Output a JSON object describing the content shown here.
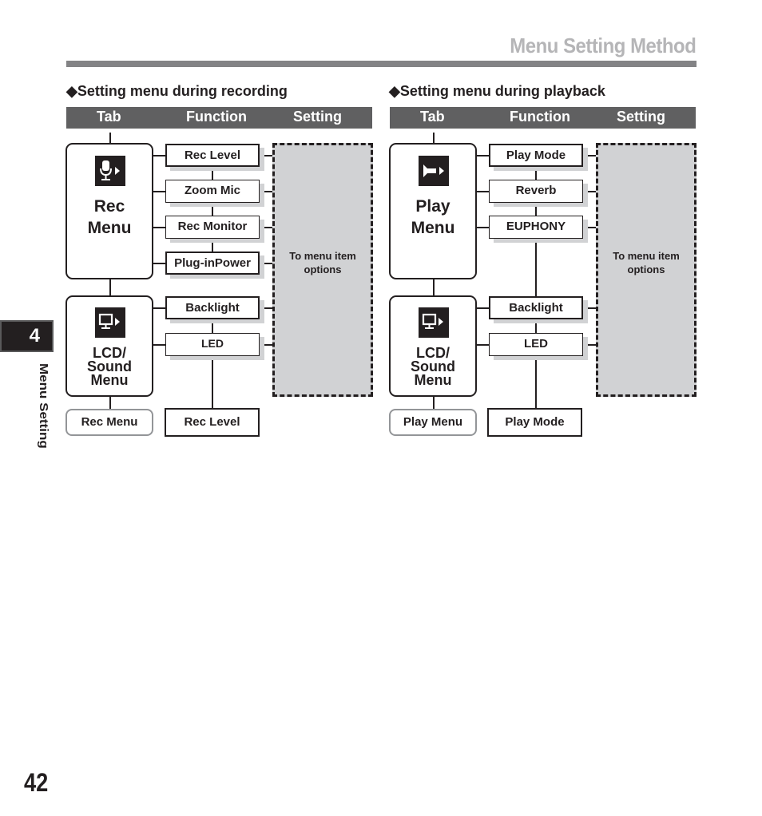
{
  "header": {
    "title": "Menu Setting Method"
  },
  "chapter": {
    "number": "4",
    "label": "Menu Setting"
  },
  "page_number": "42",
  "column_headers": {
    "tab": "Tab",
    "function": "Function",
    "setting": "Setting"
  },
  "recording": {
    "heading": "◆Setting menu during recording",
    "tabs": [
      {
        "label_lines": [
          "Rec",
          "Menu"
        ],
        "icon": "microphone-icon"
      },
      {
        "label_lines": [
          "LCD/",
          "Sound",
          "Menu"
        ],
        "icon": "monitor-icon"
      }
    ],
    "rec_menu_functions": [
      "Rec Level",
      "Zoom Mic",
      "Rec Monitor",
      "Plug-inPower"
    ],
    "lcd_menu_functions": [
      "Backlight",
      "LED"
    ],
    "return_tab": "Rec Menu",
    "return_function": "Rec Level",
    "setting_text_lines": [
      "To menu item",
      "options"
    ]
  },
  "playback": {
    "heading": "◆Setting menu during playback",
    "tabs": [
      {
        "label_lines": [
          "Play",
          "Menu"
        ],
        "icon": "play-icon"
      },
      {
        "label_lines": [
          "LCD/",
          "Sound",
          "Menu"
        ],
        "icon": "monitor-icon"
      }
    ],
    "play_menu_functions": [
      "Play Mode",
      "Reverb",
      "EUPHONY"
    ],
    "lcd_menu_functions": [
      "Backlight",
      "LED"
    ],
    "return_tab": "Play Menu",
    "return_function": "Play Mode",
    "setting_text_lines": [
      "To menu item",
      "options"
    ]
  }
}
